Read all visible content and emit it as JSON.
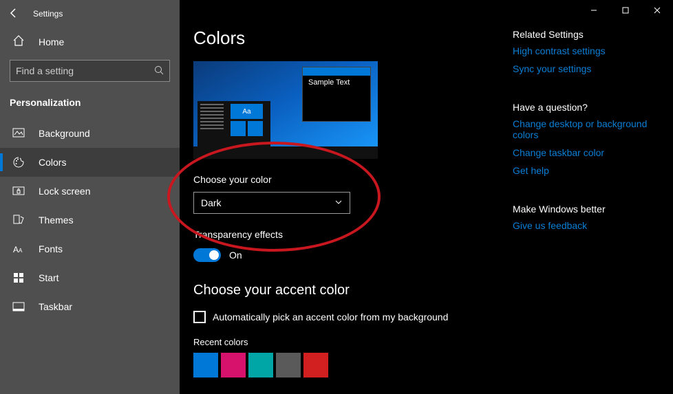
{
  "header": {
    "title": "Settings"
  },
  "sidebar": {
    "home": "Home",
    "search_placeholder": "Find a setting",
    "category": "Personalization",
    "items": [
      {
        "label": "Background"
      },
      {
        "label": "Colors"
      },
      {
        "label": "Lock screen"
      },
      {
        "label": "Themes"
      },
      {
        "label": "Fonts"
      },
      {
        "label": "Start"
      },
      {
        "label": "Taskbar"
      }
    ]
  },
  "page": {
    "title": "Colors",
    "preview": {
      "tile_text": "Aa",
      "window_text": "Sample Text"
    },
    "choose_color_label": "Choose your color",
    "choose_color_value": "Dark",
    "transparency_label": "Transparency effects",
    "transparency_state": "On",
    "accent_title": "Choose your accent color",
    "auto_pick_label": "Automatically pick an accent color from my background",
    "recent_label": "Recent colors",
    "recent_colors": [
      "#0078d7",
      "#d6126d",
      "#00a5a5",
      "#5a5a5a",
      "#d21f1f"
    ]
  },
  "rightcol": {
    "related_heading": "Related Settings",
    "related": [
      "High contrast settings",
      "Sync your settings"
    ],
    "question_heading": "Have a question?",
    "question_links": [
      "Change desktop or background colors",
      "Change taskbar color",
      "Get help"
    ],
    "better_heading": "Make Windows better",
    "better_links": [
      "Give us feedback"
    ]
  }
}
